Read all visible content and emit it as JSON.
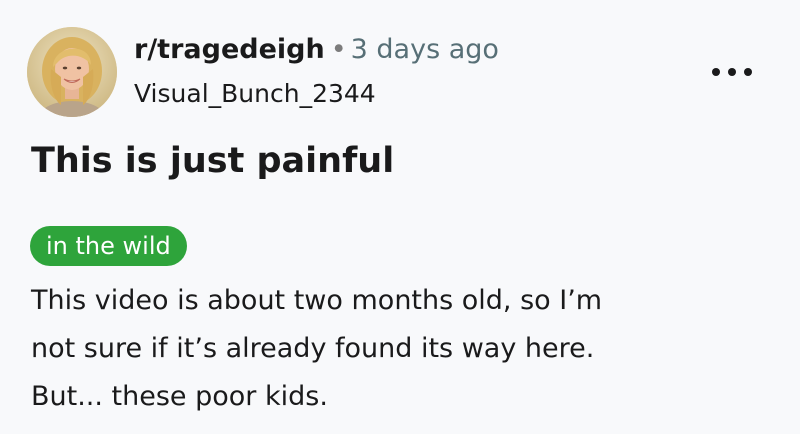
{
  "post": {
    "subreddit": "r/tragedeigh",
    "separator": "•",
    "timestamp": "3 days ago",
    "username": "Visual_Bunch_2344",
    "title": "This is just painful",
    "flair": "in the wild",
    "body_lines": [
      "This video is about two months old, so I’m",
      "not sure if it’s already found its way here.",
      "But... these poor kids."
    ]
  },
  "icons": {
    "avatar": "user-avatar",
    "more": "more-options-icon"
  },
  "colors": {
    "background": "#f8f9fb",
    "flair_background": "#2ea43b",
    "flair_text": "#ffffff",
    "text": "#1a1a1b",
    "muted": "#576f76"
  }
}
